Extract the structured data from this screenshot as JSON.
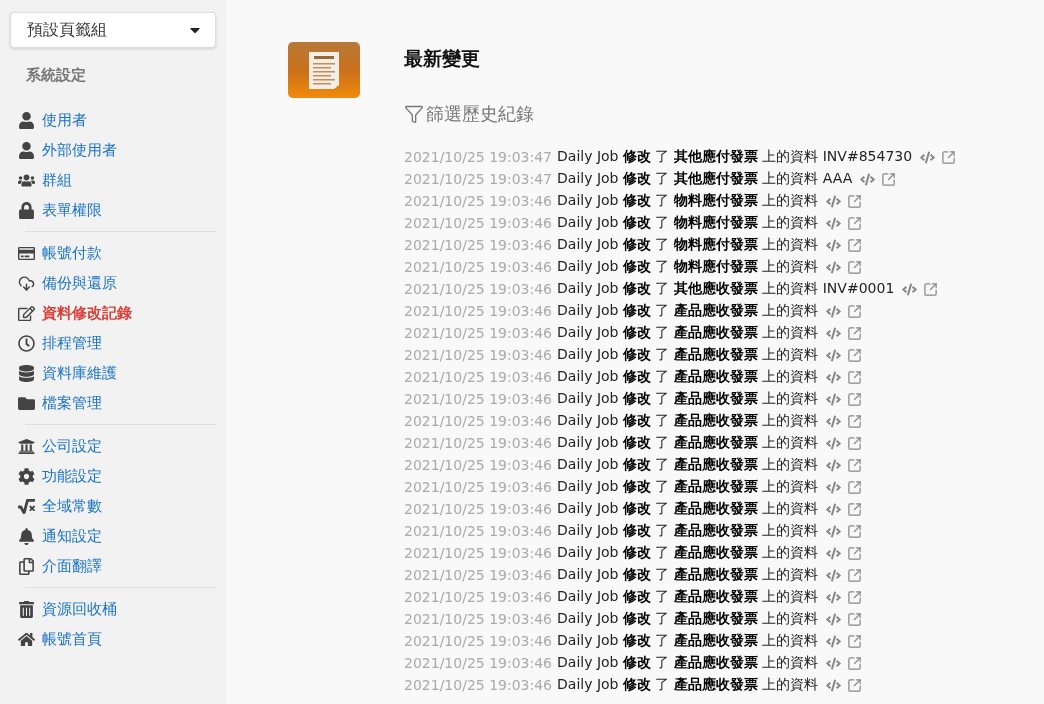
{
  "sidebar": {
    "dropdown": {
      "value": "預設頁籤組"
    },
    "heading": "系統設定",
    "groups": [
      {
        "items": [
          {
            "label": "使用者",
            "selected": false
          },
          {
            "label": "外部使用者",
            "selected": false
          },
          {
            "label": "群組",
            "selected": false
          },
          {
            "label": "表單權限",
            "selected": false
          }
        ]
      },
      {
        "items": [
          {
            "label": "帳號付款",
            "selected": false
          },
          {
            "label": "備份與還原",
            "selected": false
          },
          {
            "label": "資料修改記錄",
            "selected": true
          },
          {
            "label": "排程管理",
            "selected": false
          },
          {
            "label": "資料庫維護",
            "selected": false
          },
          {
            "label": "檔案管理",
            "selected": false
          }
        ]
      },
      {
        "items": [
          {
            "label": "公司設定",
            "selected": false
          },
          {
            "label": "功能設定",
            "selected": false
          },
          {
            "label": "全域常數",
            "selected": false
          },
          {
            "label": "通知設定",
            "selected": false
          },
          {
            "label": "介面翻譯",
            "selected": false
          }
        ]
      },
      {
        "items": [
          {
            "label": "資源回收桶",
            "selected": false
          },
          {
            "label": "帳號首頁",
            "selected": false
          }
        ]
      }
    ]
  },
  "main": {
    "title": "最新變更",
    "filter_link": "篩選歷史紀錄",
    "log": [
      {
        "time": "2021/10/25 19:03:47",
        "text": "Daily Job **修改** 了 **其他應付發票** 上的資料 INV#854730"
      },
      {
        "time": "2021/10/25 19:03:47",
        "text": "Daily Job **修改** 了 **其他應付發票** 上的資料 AAA"
      },
      {
        "time": "2021/10/25 19:03:46",
        "text": "Daily Job **修改** 了 **物料應付發票** 上的資料"
      },
      {
        "time": "2021/10/25 19:03:46",
        "text": "Daily Job **修改** 了 **物料應付發票** 上的資料"
      },
      {
        "time": "2021/10/25 19:03:46",
        "text": "Daily Job **修改** 了 **物料應付發票** 上的資料"
      },
      {
        "time": "2021/10/25 19:03:46",
        "text": "Daily Job **修改** 了 **物料應付發票** 上的資料"
      },
      {
        "time": "2021/10/25 19:03:46",
        "text": "Daily Job **修改** 了 **其他應收發票** 上的資料 INV#0001"
      },
      {
        "time": "2021/10/25 19:03:46",
        "text": "Daily Job **修改** 了 **產品應收發票** 上的資料"
      },
      {
        "time": "2021/10/25 19:03:46",
        "text": "Daily Job **修改** 了 **產品應收發票** 上的資料"
      },
      {
        "time": "2021/10/25 19:03:46",
        "text": "Daily Job **修改** 了 **產品應收發票** 上的資料"
      },
      {
        "time": "2021/10/25 19:03:46",
        "text": "Daily Job **修改** 了 **產品應收發票** 上的資料"
      },
      {
        "time": "2021/10/25 19:03:46",
        "text": "Daily Job **修改** 了 **產品應收發票** 上的資料"
      },
      {
        "time": "2021/10/25 19:03:46",
        "text": "Daily Job **修改** 了 **產品應收發票** 上的資料"
      },
      {
        "time": "2021/10/25 19:03:46",
        "text": "Daily Job **修改** 了 **產品應收發票** 上的資料"
      },
      {
        "time": "2021/10/25 19:03:46",
        "text": "Daily Job **修改** 了 **產品應收發票** 上的資料"
      },
      {
        "time": "2021/10/25 19:03:46",
        "text": "Daily Job **修改** 了 **產品應收發票** 上的資料"
      },
      {
        "time": "2021/10/25 19:03:46",
        "text": "Daily Job **修改** 了 **產品應收發票** 上的資料"
      },
      {
        "time": "2021/10/25 19:03:46",
        "text": "Daily Job **修改** 了 **產品應收發票** 上的資料"
      },
      {
        "time": "2021/10/25 19:03:46",
        "text": "Daily Job **修改** 了 **產品應收發票** 上的資料"
      },
      {
        "time": "2021/10/25 19:03:46",
        "text": "Daily Job **修改** 了 **產品應收發票** 上的資料"
      },
      {
        "time": "2021/10/25 19:03:46",
        "text": "Daily Job **修改** 了 **產品應收發票** 上的資料"
      },
      {
        "time": "2021/10/25 19:03:46",
        "text": "Daily Job **修改** 了 **產品應收發票** 上的資料"
      },
      {
        "time": "2021/10/25 19:03:46",
        "text": "Daily Job **修改** 了 **產品應收發票** 上的資料"
      },
      {
        "time": "2021/10/25 19:03:46",
        "text": "Daily Job **修改** 了 **產品應收發票** 上的資料"
      },
      {
        "time": "2021/10/25 19:03:46",
        "text": "Daily Job **修改** 了 **產品應收發票** 上的資料"
      }
    ]
  }
}
